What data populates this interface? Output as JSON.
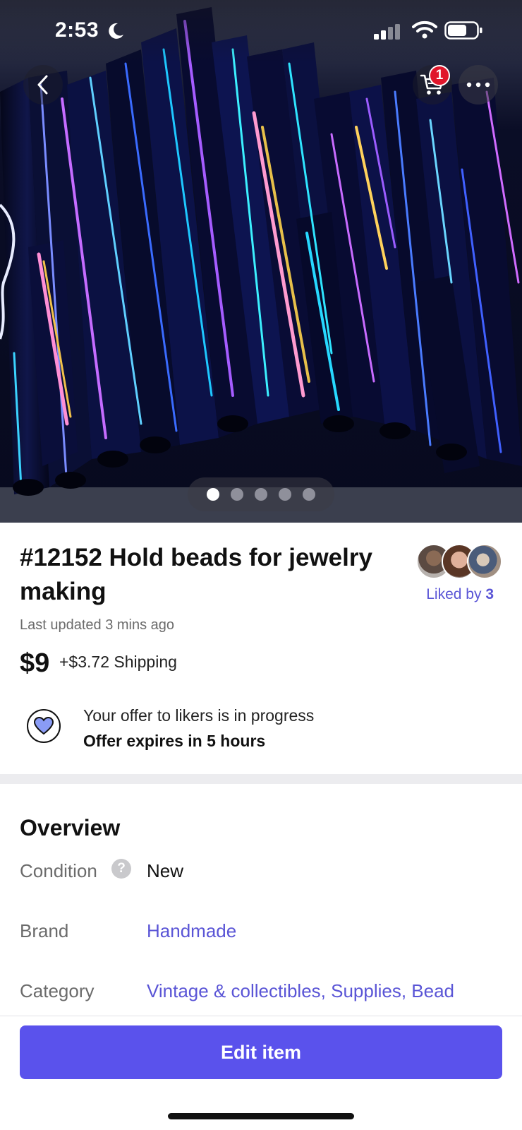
{
  "status_bar": {
    "time": "2:53"
  },
  "nav": {
    "cart_count": "1"
  },
  "carousel": {
    "total": 5,
    "active_index": 0
  },
  "item": {
    "title": "#12152 Hold beads for jewelry making",
    "liked_by_label": "Liked by",
    "liked_by_count": "3",
    "last_updated": "Last updated 3 mins ago",
    "price": "$9",
    "shipping": "+$3.72 Shipping"
  },
  "offer": {
    "line1": "Your offer to likers is in progress",
    "line2": "Offer expires in 5 hours"
  },
  "overview": {
    "title": "Overview",
    "rows": [
      {
        "label": "Condition",
        "value": "New"
      },
      {
        "label": "Brand",
        "value": "Handmade"
      },
      {
        "label": "Category",
        "value": "Vintage & collectibles, Supplies, Bead"
      }
    ]
  },
  "actions": {
    "edit_label": "Edit item"
  },
  "colors": {
    "accent": "#5a52ec",
    "link": "#5a55d6",
    "badge": "#e0162b",
    "heart_fill": "#8a9cf5"
  }
}
